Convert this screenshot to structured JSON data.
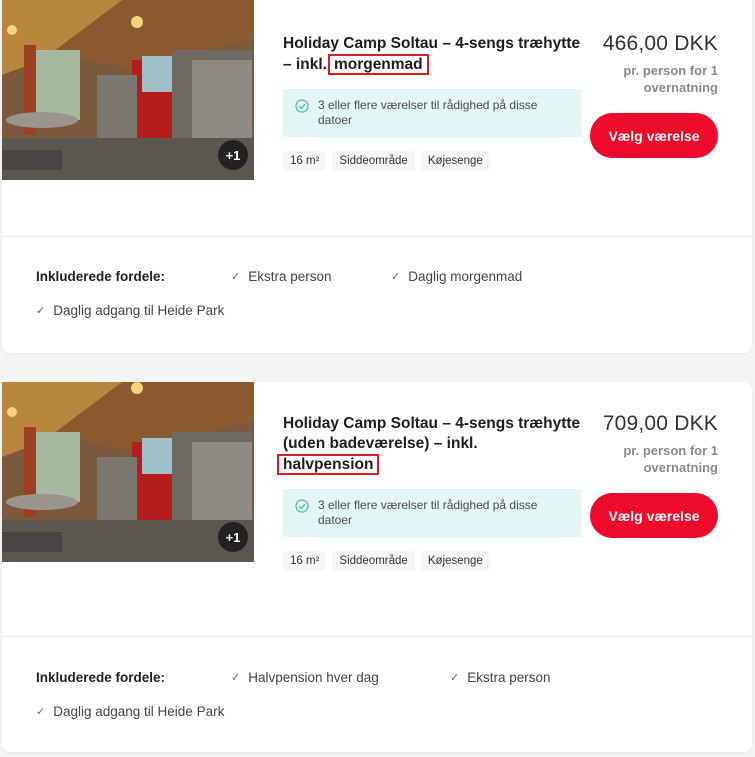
{
  "listings": [
    {
      "title_main": "Holiday Camp Soltau – 4-sengs træhytte – inkl.",
      "title_highlight": "morgenmad",
      "photo_badge": "+1",
      "availability": "3 eller flere værelser til rådighed på disse datoer",
      "tags": [
        "16 m²",
        "Siddeområde",
        "Køjesenge"
      ],
      "price": "466,00 DKK",
      "price_note": "pr. person for 1 overnatning",
      "button_label": "Vælg værelse",
      "perks_title": "Inkluderede fordele:",
      "perks": [
        "Ekstra person",
        "Daglig morgenmad",
        "Daglig adgang til Heide Park"
      ]
    },
    {
      "title_main": "Holiday Camp Soltau – 4-sengs træhytte (uden badeværelse) – inkl.",
      "title_highlight": "halvpension",
      "photo_badge": "+1",
      "availability": "3 eller flere værelser til rådighed på disse datoer",
      "tags": [
        "16 m²",
        "Siddeområde",
        "Køjesenge"
      ],
      "price": "709,00 DKK",
      "price_note": "pr. person for 1 overnatning",
      "button_label": "Vælg værelse",
      "perks_title": "Inkluderede fordele:",
      "perks": [
        "Halvpension hver dag",
        "Ekstra person",
        "Daglig adgang til Heide Park"
      ]
    }
  ],
  "colors": {
    "accent_button": "#ee0a2a",
    "availability_bg": "#e4f6f3",
    "highlight_border": "#d42020",
    "check_green": "#3fbf9a"
  },
  "icons": {
    "availability": "check-circle-icon",
    "perk": "checkmark-icon",
    "photo_more": "photo-count-badge"
  }
}
